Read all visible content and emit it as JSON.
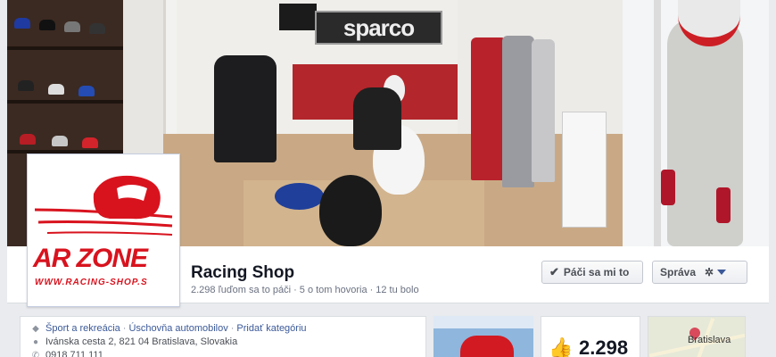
{
  "cover": {
    "sign_text": "sparco"
  },
  "profile": {
    "logo_text": "AR ZONE",
    "logo_url": "WWW.RACING-SHOP.S"
  },
  "page": {
    "title": "Racing Shop",
    "stats": {
      "likes": "2.298 ľuďom sa to páči",
      "talking": "5 o tom hovoria",
      "were_here": "12 tu bolo"
    }
  },
  "actions": {
    "like_label": "Páči sa mi to",
    "manage_label": "Správa"
  },
  "about": {
    "categories": [
      "Šport a rekreácia",
      "Úschovňa automobilov",
      "Pridať kategóriu"
    ],
    "address": "Ivánska cesta 2, 821 04 Bratislava, Slovakia",
    "phone": "0918 711 111"
  },
  "likes_box": {
    "count": "2.298"
  },
  "map": {
    "city": "Bratislava"
  },
  "colors": {
    "brand_red": "#d8131e",
    "link_blue": "#3b5998"
  },
  "icons": {
    "like_check": "check-icon",
    "manage_gear": "gear-icon",
    "category": "tag-icon",
    "address": "location-pin-icon",
    "phone": "phone-icon",
    "likes": "thumbs-up-icon"
  }
}
